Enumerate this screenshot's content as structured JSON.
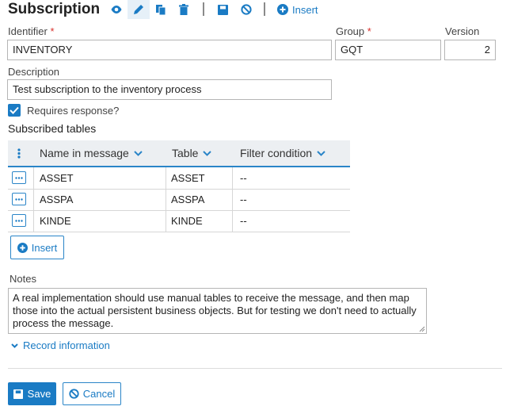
{
  "header": {
    "title": "Subscription",
    "insert_label": "Insert"
  },
  "toolbar_icons": [
    "eye-icon",
    "pencil-icon",
    "copy-icon",
    "trash-icon",
    "save-icon",
    "cancel-icon",
    "plus-circle-icon"
  ],
  "colors": {
    "accent": "#1a7bc4",
    "required": "#d9302b",
    "header_bg": "#eceff2"
  },
  "form": {
    "identifier": {
      "label": "Identifier",
      "value": "INVENTORY",
      "required": "*"
    },
    "group": {
      "label": "Group",
      "value": "GQT",
      "required": "*"
    },
    "version": {
      "label": "Version",
      "value": "2"
    },
    "description": {
      "label": "Description",
      "value": "Test subscription to the inventory process"
    },
    "requires_response": {
      "label": "Requires response?",
      "checked": true
    }
  },
  "subscribed_tables": {
    "heading": "Subscribed tables",
    "columns": [
      "Name in message",
      "Table",
      "Filter condition"
    ],
    "rows": [
      {
        "name": "ASSET",
        "table": "ASSET",
        "filter": "--"
      },
      {
        "name": "ASSPA",
        "table": "ASSPA",
        "filter": "--"
      },
      {
        "name": "KINDE",
        "table": "KINDE",
        "filter": "--"
      }
    ],
    "insert_label": "Insert"
  },
  "notes": {
    "label": "Notes",
    "value": "A real implementation should use manual tables to receive the message, and then map those into the actual persistent business objects. But for testing we don't need to actually process the message."
  },
  "record_info_label": "Record information",
  "footer": {
    "save_label": "Save",
    "cancel_label": "Cancel"
  }
}
